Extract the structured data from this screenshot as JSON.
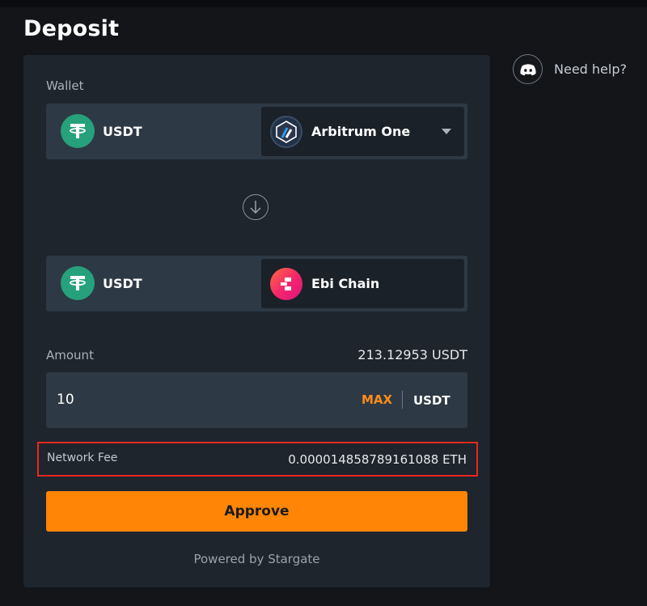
{
  "page": {
    "title": "Deposit"
  },
  "wallet": {
    "label": "Wallet",
    "from": {
      "token": "USDT",
      "token_icon": "tether-icon",
      "chain": "Arbitrum One",
      "chain_icon": "arbitrum-icon"
    },
    "to": {
      "token": "USDT",
      "token_icon": "tether-icon",
      "chain": "Ebi Chain",
      "chain_icon": "ebi-chain-icon"
    }
  },
  "amount": {
    "label": "Amount",
    "balance": "213.12953 USDT",
    "value": "10",
    "max_label": "MAX",
    "unit": "USDT"
  },
  "fee": {
    "label": "Network Fee",
    "value": "0.000014858789161088 ETH"
  },
  "actions": {
    "approve_label": "Approve"
  },
  "footer": {
    "powered_by": "Powered by Stargate"
  },
  "help": {
    "label": "Need help?",
    "icon": "discord-icon"
  },
  "colors": {
    "accent": "#ff8507",
    "max": "#ff8c1a",
    "highlight_border": "#e8281e",
    "tether": "#26a17b",
    "card": "#1e252d",
    "background": "#131519"
  }
}
